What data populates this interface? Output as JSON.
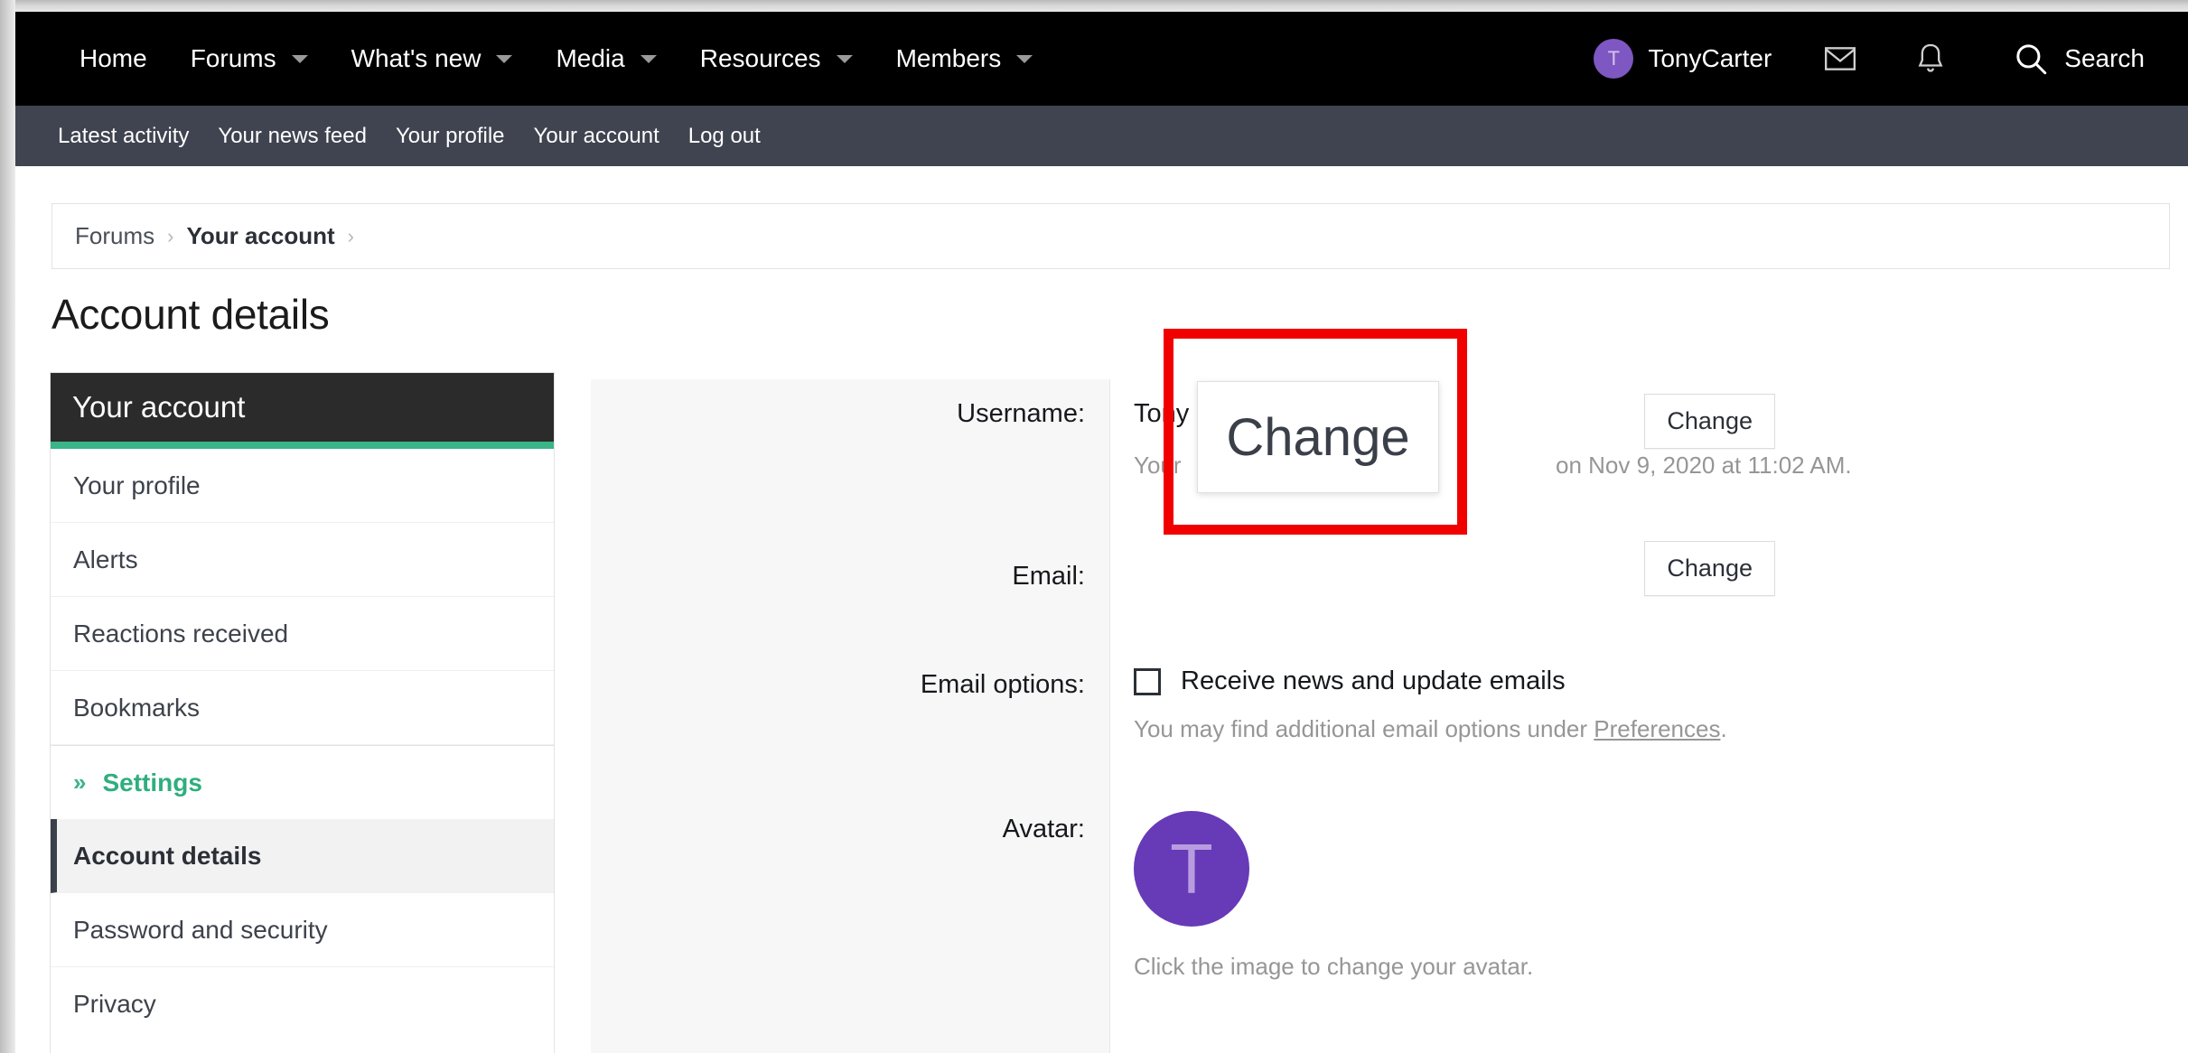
{
  "topnav": {
    "items": [
      {
        "label": "Home",
        "caret": false
      },
      {
        "label": "Forums",
        "caret": true
      },
      {
        "label": "What's new",
        "caret": true
      },
      {
        "label": "Media",
        "caret": true
      },
      {
        "label": "Resources",
        "caret": true
      },
      {
        "label": "Members",
        "caret": true
      }
    ],
    "user": {
      "initial": "T",
      "name": "TonyCarter"
    },
    "icons": {
      "inbox": "envelope-icon",
      "alerts": "bell-icon",
      "search": "search-icon"
    },
    "search_label": "Search"
  },
  "subnav": {
    "items": [
      "Latest activity",
      "Your news feed",
      "Your profile",
      "Your account",
      "Log out"
    ]
  },
  "breadcrumb": {
    "root": "Forums",
    "current": "Your account",
    "sep": "›"
  },
  "page": {
    "title": "Account details"
  },
  "sidebar": {
    "header": "Your account",
    "items": [
      {
        "label": "Your profile",
        "active": false
      },
      {
        "label": "Alerts",
        "active": false
      },
      {
        "label": "Reactions received",
        "active": false
      },
      {
        "label": "Bookmarks",
        "active": false
      }
    ],
    "section": {
      "chevron": "»",
      "label": "Settings"
    },
    "settings_items": [
      {
        "label": "Account details",
        "active": true
      },
      {
        "label": "Password and security",
        "active": false
      },
      {
        "label": "Privacy",
        "active": false
      }
    ]
  },
  "form": {
    "rows": {
      "username": {
        "label": "Username:",
        "value": "Tony",
        "hint_before": "Your",
        "hint_after": "on Nov 9, 2020 at 11:02 AM.",
        "button": "Change"
      },
      "email": {
        "label": "Email:",
        "value": "",
        "button": "Change"
      },
      "email_options": {
        "label": "Email options:",
        "checkbox_label": "Receive news and update emails",
        "checked": false,
        "hint_pre": "You may find additional email options under ",
        "hint_link": "Preferences",
        "hint_post": "."
      },
      "avatar": {
        "label": "Avatar:",
        "initial": "T",
        "hint": "Click the image to change your avatar."
      }
    }
  },
  "annotation": {
    "magnified_label": "Change",
    "border_color": "#f10000"
  }
}
